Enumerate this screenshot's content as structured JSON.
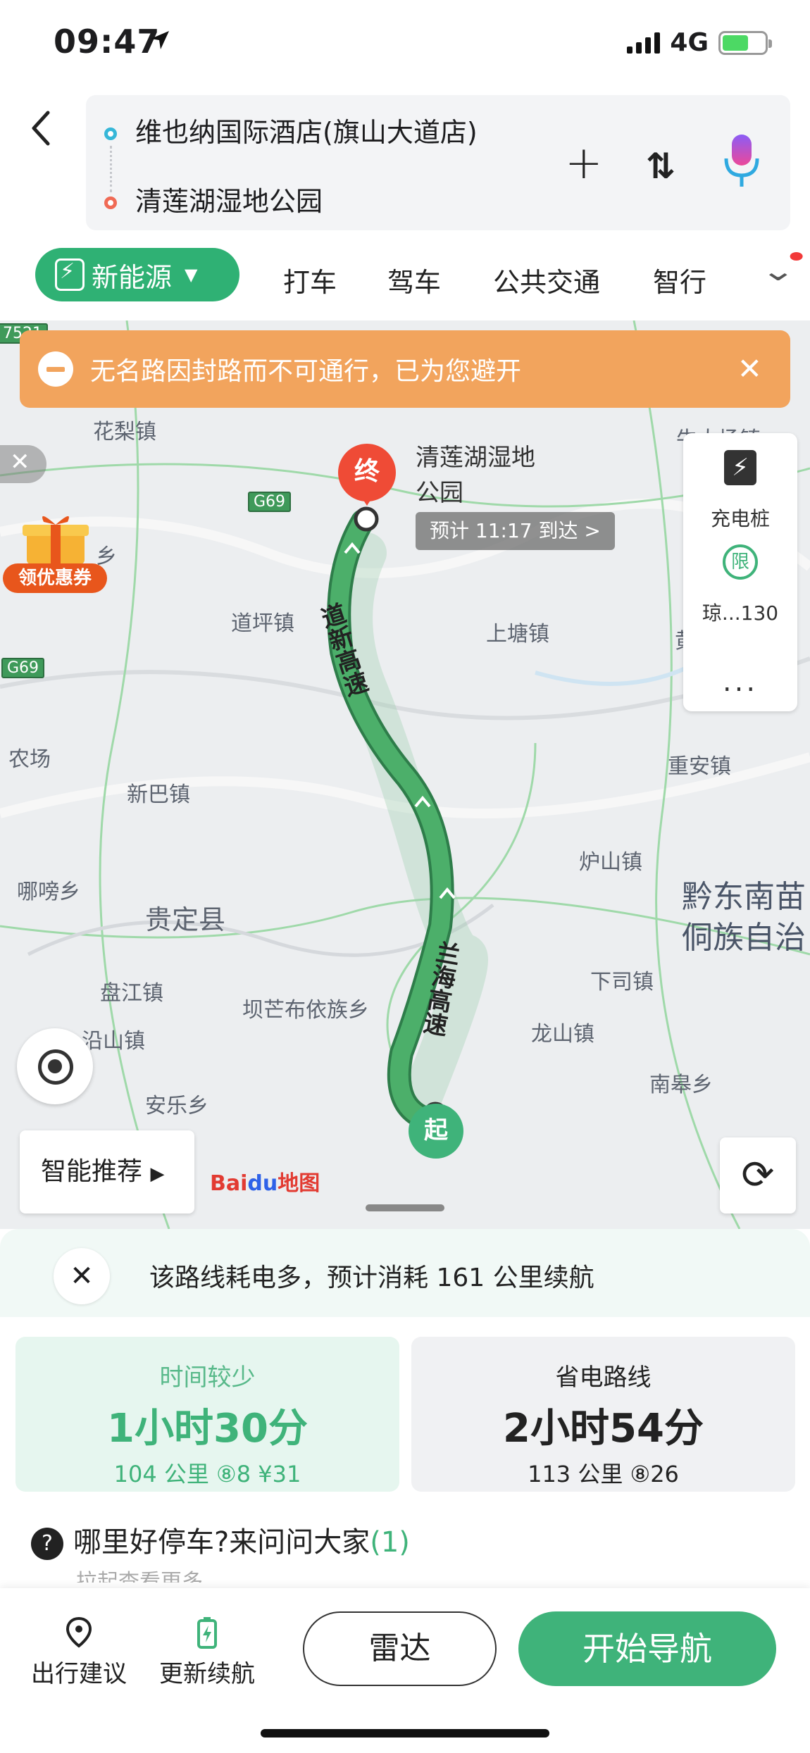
{
  "status": {
    "time": "09:47",
    "network": "4G"
  },
  "route": {
    "from": "维也纳国际酒店(旗山大道店)",
    "to": "清莲湖湿地公园",
    "plus_icon": "+",
    "swap_icon": "⇅"
  },
  "tabs": {
    "active": "新能源",
    "items": [
      "打车",
      "驾车",
      "公共交通",
      "智行"
    ]
  },
  "map": {
    "alert": "无名路因封路而不可通行，已为您避开",
    "coupon": "领优惠券",
    "destination_pin": "终",
    "destination_name": "清莲湖湿地公园",
    "eta": "预计 11:17 到达 >",
    "start_pin": "起",
    "highways": [
      "道新高速",
      "兰海高速"
    ],
    "places": [
      "花梨镇",
      "道坪镇",
      "上塘镇",
      "农场",
      "新巴镇",
      "重安镇",
      "炉山镇",
      "哪嗙乡",
      "贵定县",
      "盘江镇",
      "坝芒布依族乡",
      "下司镇",
      "沿山镇",
      "龙山镇",
      "南皋乡",
      "安乐乡",
      "乡",
      "黄",
      "牛大场镇"
    ],
    "region_label": [
      "黔东南苗",
      "侗族自治"
    ],
    "shields": [
      "G69",
      "G69",
      "7521"
    ],
    "side_panel": {
      "charging": "充电桩",
      "limit_icon": "限",
      "limit_text": "琼...130",
      "more": "..."
    },
    "smart_button": "智能推荐",
    "brand": {
      "bai": "Bai",
      "du": "du",
      "map": "地图"
    }
  },
  "sheet": {
    "energy_notice": "该路线耗电多，预计消耗 161 公里续航",
    "options": [
      {
        "label": "时间较少",
        "time": "1小时30分",
        "meta": "104 公里  ⑧8 ¥31"
      },
      {
        "label": "省电路线",
        "time": "2小时54分",
        "meta": "113 公里  ⑧26"
      }
    ],
    "qa": {
      "text": "哪里好停车?来问问大家",
      "count": "(1)",
      "hint": "拉起查看更多"
    },
    "toolbar": {
      "travel_advice": "出行建议",
      "update_range": "更新续航",
      "radar": "雷达",
      "start_nav": "开始导航"
    }
  },
  "colors": {
    "accent": "#3fb37a",
    "alert": "#f2a45d",
    "route": "#4caf6a",
    "dest": "#ef4b36"
  }
}
